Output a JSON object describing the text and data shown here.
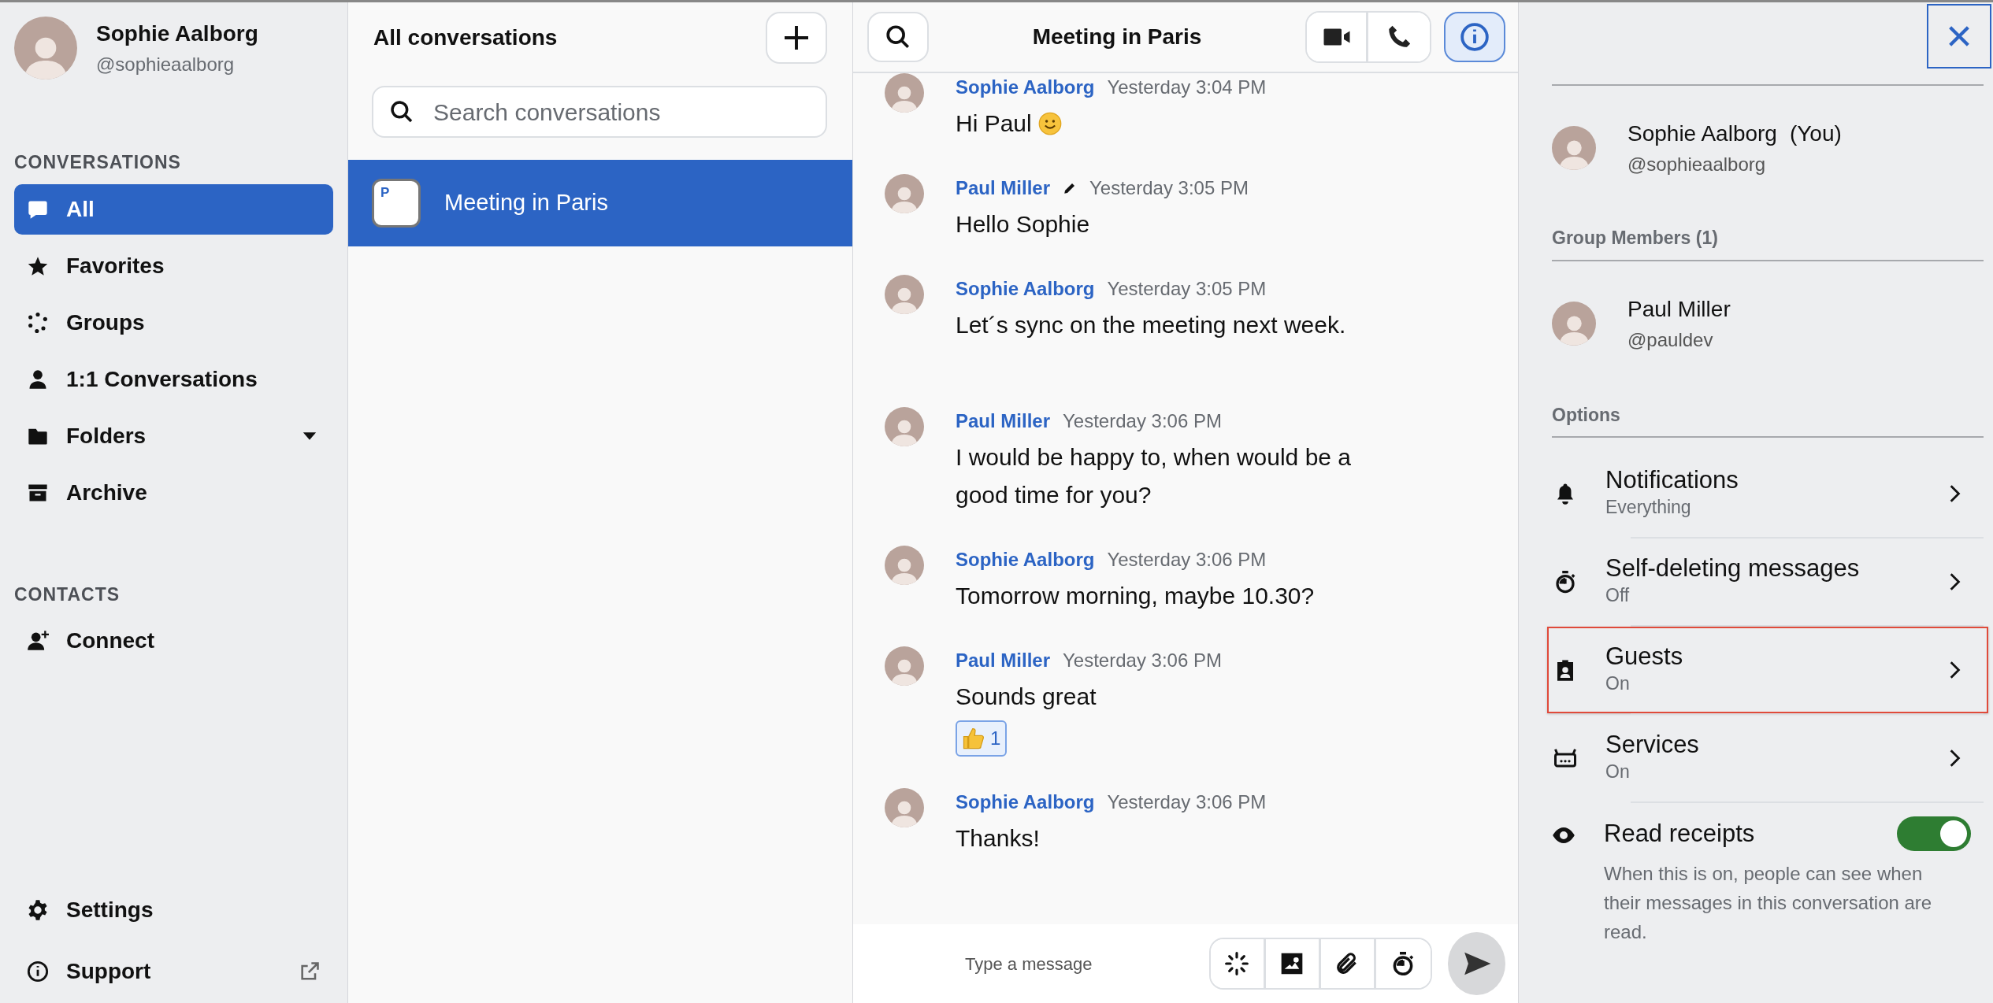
{
  "profile": {
    "name": "Sophie Aalborg",
    "handle": "@sophieaalborg"
  },
  "sidebar": {
    "sections": [
      {
        "title": "CONVERSATIONS",
        "items": [
          {
            "label": "All",
            "selected": true,
            "dropdown": false
          },
          {
            "label": "Favorites",
            "selected": false,
            "dropdown": false
          },
          {
            "label": "Groups",
            "selected": false,
            "dropdown": false
          },
          {
            "label": "1:1 Conversations",
            "selected": false,
            "dropdown": false
          },
          {
            "label": "Folders",
            "selected": false,
            "dropdown": true
          },
          {
            "label": "Archive",
            "selected": false,
            "dropdown": false
          }
        ]
      },
      {
        "title": "CONTACTS",
        "items": [
          {
            "label": "Connect",
            "selected": false,
            "dropdown": false
          }
        ]
      }
    ],
    "footer_items": [
      {
        "label": "Settings",
        "external": false
      },
      {
        "label": "Support",
        "external": true
      }
    ]
  },
  "conversation_list": {
    "title": "All conversations",
    "search": {
      "placeholder": "Search conversations"
    },
    "items": [
      {
        "initial": "P",
        "name": "Meeting in Paris",
        "selected": true
      }
    ]
  },
  "chat": {
    "title": "Meeting in Paris",
    "info_active": true,
    "messages": [
      {
        "kind": "emoji",
        "author": "Sophie Aalborg",
        "edited": false,
        "time": "Yesterday 3:04 PM",
        "text": "Hi Paul"
      },
      {
        "kind": "text",
        "author": "Paul Miller",
        "edited": true,
        "time": "Yesterday 3:05 PM",
        "text": "Hello Sophie"
      },
      {
        "kind": "text",
        "author": "Sophie Aalborg",
        "edited": false,
        "time": "Yesterday 3:05 PM",
        "text": "Let´s sync on the meeting next week."
      },
      {
        "kind": "text",
        "author": "Paul Miller",
        "edited": false,
        "time": "Yesterday 3:06 PM",
        "text": "I would be happy to, when would be a good time for you?"
      },
      {
        "kind": "text",
        "author": "Sophie Aalborg",
        "edited": false,
        "time": "Yesterday 3:06 PM",
        "text": "Tomorrow morning, maybe 10.30?"
      },
      {
        "kind": "text",
        "author": "Paul Miller",
        "edited": false,
        "time": "Yesterday 3:06 PM",
        "text": "Sounds great",
        "reactions": [
          {
            "count": "1",
            "selected": true
          }
        ]
      },
      {
        "kind": "text",
        "author": "Sophie Aalborg",
        "edited": false,
        "time": "Yesterday 3:06 PM",
        "text": "Thanks!"
      }
    ],
    "composer": {
      "placeholder": "Type a message"
    }
  },
  "details": {
    "self": {
      "name": "Sophie Aalborg",
      "suffix": "(You)",
      "handle": "@sophieaalborg"
    },
    "members_title": "Group Members (1)",
    "members": [
      {
        "name": "Paul Miller",
        "handle": "@pauldev"
      }
    ],
    "options_title": "Options",
    "options": [
      {
        "kind": "link",
        "title": "Notifications",
        "value": "Everything",
        "highlighted": false
      },
      {
        "kind": "link",
        "title": "Self-deleting messages",
        "value": "Off",
        "highlighted": false
      },
      {
        "kind": "link",
        "title": "Guests",
        "value": "On",
        "highlighted": true
      },
      {
        "kind": "link",
        "title": "Services",
        "value": "On",
        "highlighted": false
      },
      {
        "kind": "toggle",
        "title": "Read receipts",
        "on": true,
        "description": "When this is on, people can see when their messages in this conversation are read."
      }
    ]
  }
}
